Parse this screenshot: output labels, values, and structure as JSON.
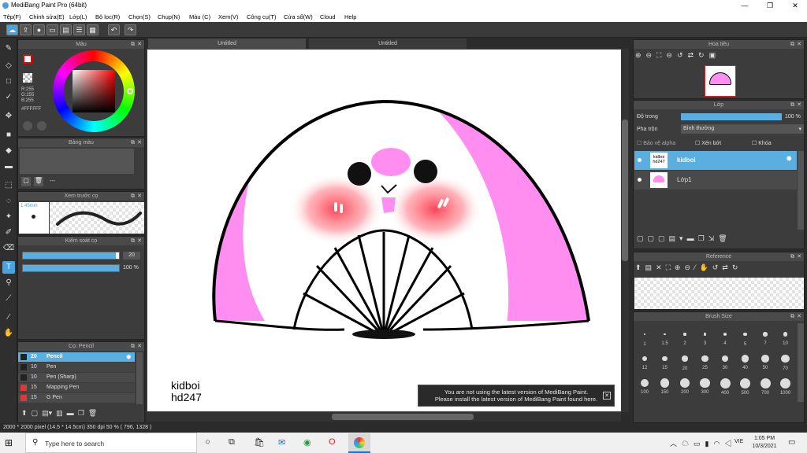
{
  "app": {
    "title": "MediBang Paint Pro (64bit)"
  },
  "menu": [
    "Tệp(F)",
    "Chỉnh sửa(E)",
    "Lớp(L)",
    "Bộ lọc(R)",
    "Chọn(S)",
    "Chụp(N)",
    "Màu (C)",
    "Xem(V)",
    "Công cụ(T)",
    "Cửa sổ(W)",
    "Cloud",
    "Help"
  ],
  "tabs": [
    "Untitled",
    "Untitled"
  ],
  "color_panel": {
    "title": "Màu",
    "r": "R:255",
    "g": "G:255",
    "b": "B:255",
    "hex": "#FFFFFF"
  },
  "palette_panel": {
    "title": "Bảng màu",
    "dash": "---"
  },
  "brush_preview": {
    "title": "Xem trước cọ",
    "size": "1.45mm"
  },
  "brush_control": {
    "title": "Kiểm soát cọ",
    "size_value": "20",
    "opacity_value": "100 %",
    "size_level": 0.97,
    "opacity_level": 1.0
  },
  "brush_list": {
    "title": "Cọ: Pencil",
    "items": [
      {
        "size": "20",
        "name": "Pencil",
        "color": "#222222",
        "selected": true
      },
      {
        "size": "10",
        "name": "Pen",
        "color": "#222222",
        "selected": false
      },
      {
        "size": "10",
        "name": "Pen (Sharp)",
        "color": "#222222",
        "selected": false
      },
      {
        "size": "15",
        "name": "Mapping Pen",
        "color": "#d93a3a",
        "selected": false
      },
      {
        "size": "15",
        "name": "G Pen",
        "color": "#d93a3a",
        "selected": false
      }
    ]
  },
  "navigator": {
    "title": "Hoa tiêu"
  },
  "layers": {
    "title": "Lớp",
    "opacity_label": "Độ trong",
    "opacity_value": "100 %",
    "blend_label": "Pha trộn",
    "blend_value": "Bình thường",
    "protect_alpha": "Bảo vệ alpha",
    "clipping": "Xén bớt",
    "lock": "Khóa",
    "items": [
      {
        "name": "kidboi",
        "thumb_text": "kidboi hd247",
        "selected": true
      },
      {
        "name": "Lớp1",
        "thumb_text": "",
        "selected": false
      }
    ]
  },
  "reference": {
    "title": "Reference"
  },
  "brush_size": {
    "title": "Brush Size",
    "sizes": [
      "1",
      "1.5",
      "2",
      "3",
      "4",
      "5",
      "7",
      "10",
      "12",
      "15",
      "20",
      "25",
      "30",
      "40",
      "50",
      "70",
      "100",
      "150",
      "200",
      "300",
      "400",
      "500",
      "700",
      "1000"
    ]
  },
  "canvas": {
    "text_line1": "kidboi",
    "text_line2": "hd247"
  },
  "notification": {
    "line1": "You are not using the latest version of MediBang Paint.",
    "line2": "Please install the latest version of MediBang Paint found here."
  },
  "status": "2000 * 2000 pixel   (14.5 * 14.5cm)   350 dpi   50 %   ( 796, 1328 )",
  "taskbar": {
    "search_placeholder": "Type here to search",
    "time": "1:05 PM",
    "date": "10/3/2021",
    "lang": "VIE"
  }
}
